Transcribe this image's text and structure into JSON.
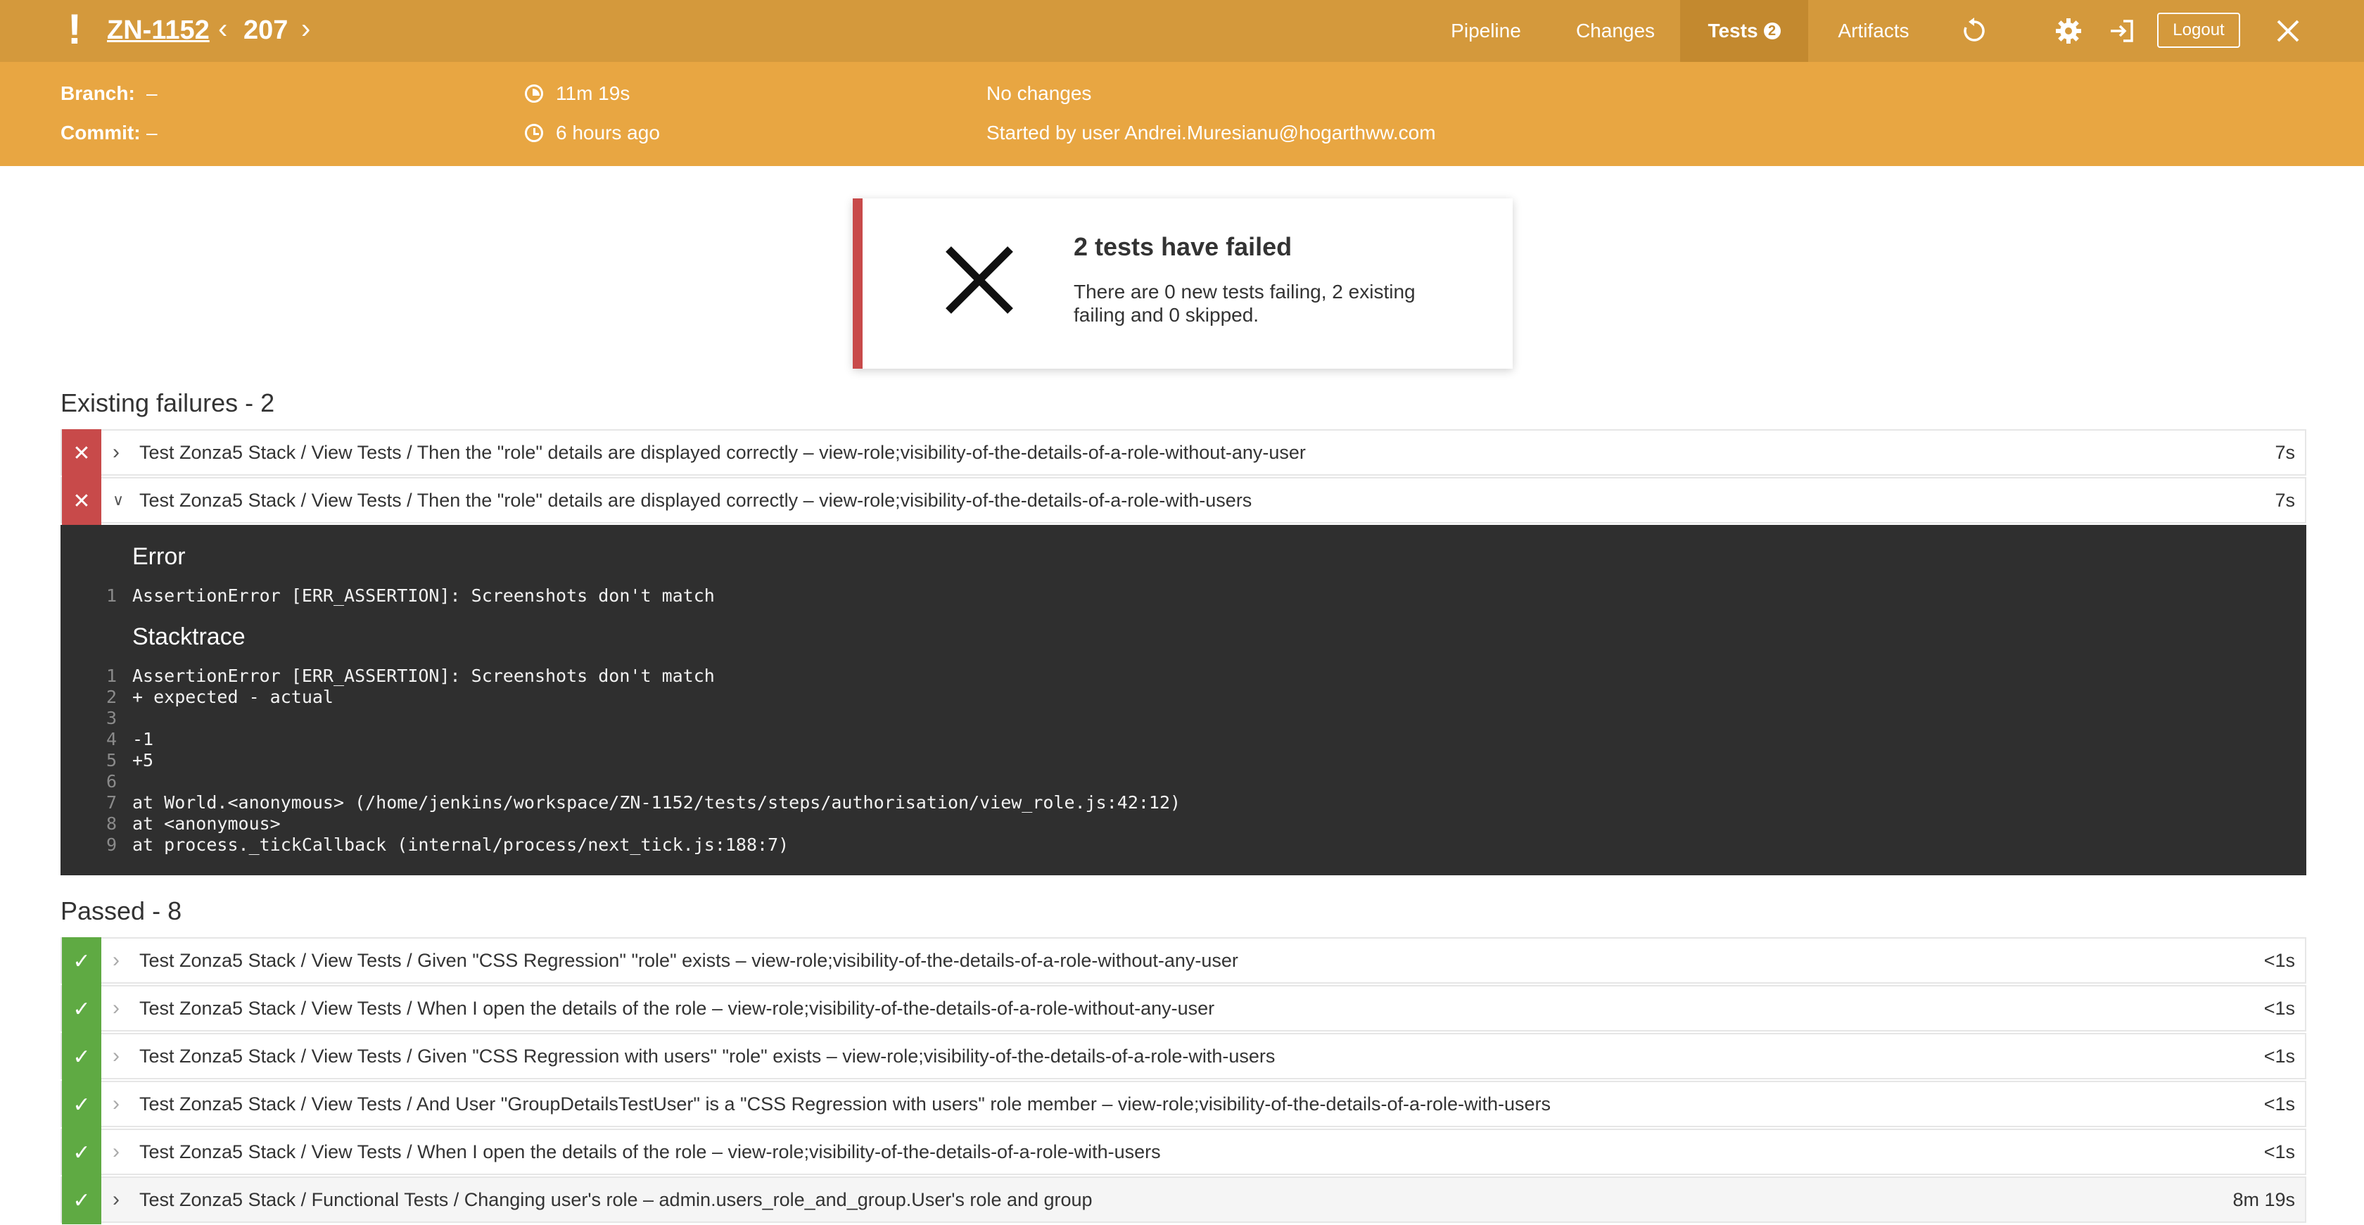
{
  "header": {
    "alert_glyph": "!",
    "job_id": "ZN-1152",
    "build_number": "207",
    "prev_glyph": "‹",
    "next_glyph": "›",
    "nav": {
      "pipeline": "Pipeline",
      "changes": "Changes",
      "tests": "Tests",
      "tests_count": "2",
      "artifacts": "Artifacts"
    },
    "logout": "Logout",
    "icons": [
      "replay-icon",
      "gear-icon",
      "sign-in-icon",
      "close-icon"
    ]
  },
  "info": {
    "branch_label": "Branch:",
    "branch_value": "–",
    "commit_label": "Commit:",
    "commit_value": "–",
    "duration": "11m 19s",
    "started_ago": "6 hours ago",
    "changes": "No changes",
    "started_by": "Started by user Andrei.Muresianu@hogarthww.com"
  },
  "summary": {
    "title": "2 tests have failed",
    "description": "There are 0 new tests failing, 2 existing failing and 0 skipped."
  },
  "failures": {
    "title": "Existing failures - 2",
    "rows": [
      {
        "name": "Test Zonza5 Stack / View Tests / Then the \"role\" details are displayed correctly – view-role;visibility-of-the-details-of-a-role-without-any-user",
        "duration": "7s",
        "expanded": false
      },
      {
        "name": "Test Zonza5 Stack / View Tests / Then the \"role\" details are displayed correctly – view-role;visibility-of-the-details-of-a-role-with-users",
        "duration": "7s",
        "expanded": true
      }
    ]
  },
  "error_panel": {
    "error_heading": "Error",
    "error_lines": [
      {
        "n": "1",
        "text": "AssertionError [ERR_ASSERTION]: Screenshots don't match"
      }
    ],
    "stack_heading": "Stacktrace",
    "stack_lines": [
      {
        "n": "1",
        "text": "AssertionError [ERR_ASSERTION]: Screenshots don't match"
      },
      {
        "n": "2",
        "text": "+ expected - actual"
      },
      {
        "n": "3",
        "text": ""
      },
      {
        "n": "4",
        "text": "-1"
      },
      {
        "n": "5",
        "text": "+5"
      },
      {
        "n": "6",
        "text": ""
      },
      {
        "n": "7",
        "text": "at World.<anonymous> (/home/jenkins/workspace/ZN-1152/tests/steps/authorisation/view_role.js:42:12)"
      },
      {
        "n": "8",
        "text": "at <anonymous>"
      },
      {
        "n": "9",
        "text": "at process._tickCallback (internal/process/next_tick.js:188:7)"
      }
    ]
  },
  "passed": {
    "title": "Passed - 8",
    "rows": [
      {
        "name": "Test Zonza5 Stack / View Tests / Given \"CSS Regression\" \"role\" exists – view-role;visibility-of-the-details-of-a-role-without-any-user",
        "duration": "<1s"
      },
      {
        "name": "Test Zonza5 Stack / View Tests / When I open the details of the role – view-role;visibility-of-the-details-of-a-role-without-any-user",
        "duration": "<1s"
      },
      {
        "name": "Test Zonza5 Stack / View Tests / Given \"CSS Regression with users\" \"role\" exists – view-role;visibility-of-the-details-of-a-role-with-users",
        "duration": "<1s"
      },
      {
        "name": "Test Zonza5 Stack / View Tests / And User \"GroupDetailsTestUser\" is a \"CSS Regression with users\" role member – view-role;visibility-of-the-details-of-a-role-with-users",
        "duration": "<1s"
      },
      {
        "name": "Test Zonza5 Stack / View Tests / When I open the details of the role – view-role;visibility-of-the-details-of-a-role-with-users",
        "duration": "<1s"
      },
      {
        "name": "Test Zonza5 Stack / Functional Tests / Changing user's role – admin.users_role_and_group.User's role and group",
        "duration": "8m 19s"
      }
    ]
  },
  "colors": {
    "header_bg": "#d4993c",
    "info_bg": "#e8a642",
    "fail": "#c84a4a",
    "pass": "#5faa43",
    "console_bg": "#2f2f2f"
  }
}
